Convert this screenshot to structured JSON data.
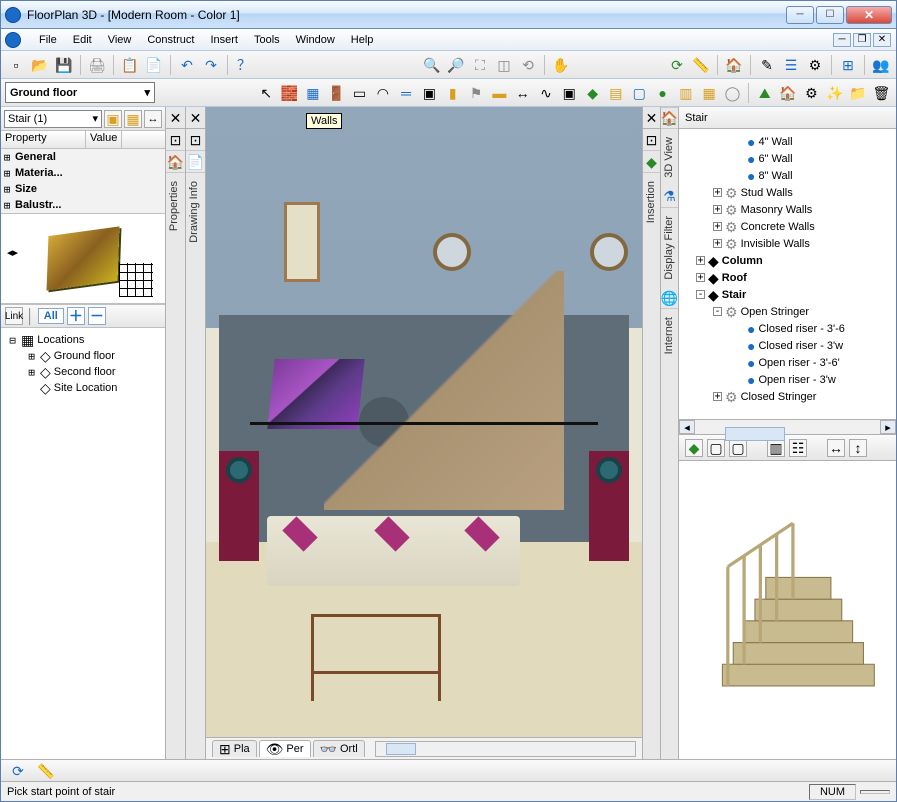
{
  "window": {
    "title": "FloorPlan 3D - [Modern Room - Color 1]"
  },
  "menu": {
    "items": [
      "File",
      "Edit",
      "View",
      "Construct",
      "Insert",
      "Tools",
      "Window",
      "Help"
    ]
  },
  "floor_dropdown": {
    "value": "Ground floor"
  },
  "tooltip_walls": "Walls",
  "properties": {
    "selector_value": "Stair (1)",
    "header_property": "Property",
    "header_value": "Value",
    "groups": [
      "General",
      "Materia...",
      "Size",
      "Balustr..."
    ]
  },
  "locations": {
    "toolbar": {
      "link": "Link",
      "all": "All"
    },
    "root": "Locations",
    "children": [
      "Ground floor",
      "Second floor",
      "Site Location"
    ]
  },
  "vertical_panels": {
    "left1": "Properties",
    "left2": "Drawing Info",
    "right1": "Insertion",
    "right2": "3D View",
    "right3": "Display Filter",
    "right4": "Internet"
  },
  "view_tabs": {
    "tab1": "Pla",
    "tab2": "Per",
    "tab3": "Ortl"
  },
  "right_tree": {
    "title": "Stair",
    "nodes": {
      "w4": "4\" Wall",
      "w6": "6\" Wall",
      "w8": "8\" Wall",
      "stud": "Stud Walls",
      "masonry": "Masonry Walls",
      "concrete": "Concrete Walls",
      "invisible": "Invisible Walls",
      "column": "Column",
      "roof": "Roof",
      "stair": "Stair",
      "open_stringer": "Open Stringer",
      "cr36": "Closed riser - 3'-6",
      "cr3w": "Closed riser - 3'w",
      "or36": "Open riser - 3'-6'",
      "or3w": "Open riser - 3'w",
      "closed_stringer": "Closed Stringer"
    }
  },
  "status": {
    "message": "Pick start point of stair",
    "num": "NUM"
  }
}
